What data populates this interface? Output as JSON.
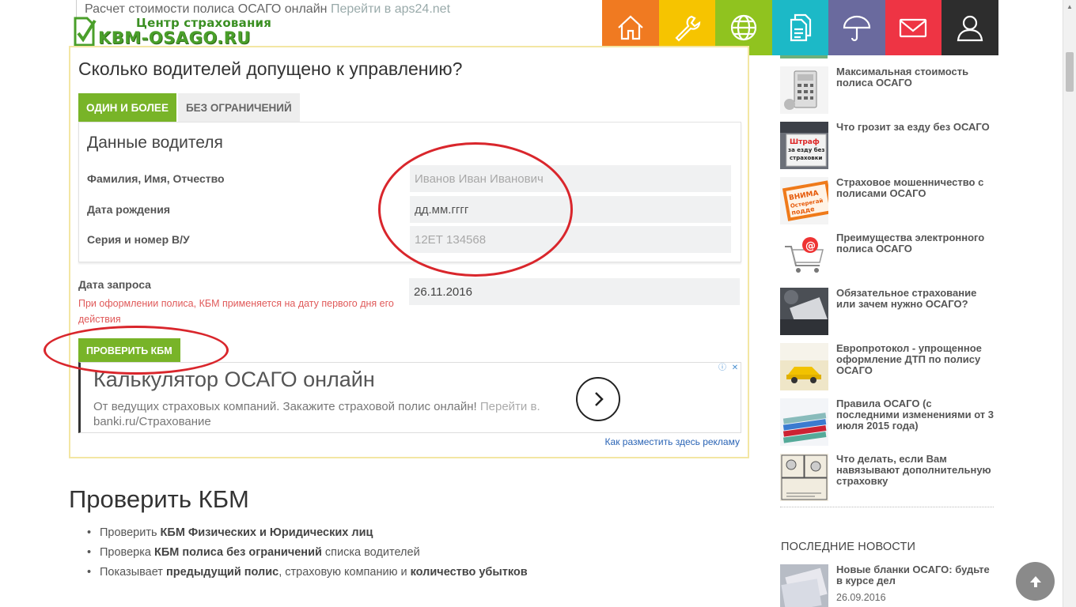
{
  "top_ad": {
    "text": "Расчет стоимости полиса ОСАГО онлайн",
    "link": "Перейти в aps24.net"
  },
  "logo": {
    "top_text": "Центр страхования",
    "main_text": "KBM-OSAGO.RU"
  },
  "topnav": [
    {
      "icon": "home-icon",
      "color": "#f07a21"
    },
    {
      "icon": "wrench-icon",
      "color": "#f6c400"
    },
    {
      "icon": "globe-icon",
      "color": "#90c31f"
    },
    {
      "icon": "documents-icon",
      "color": "#1cb9c7"
    },
    {
      "icon": "umbrella-icon",
      "color": "#6a6a9e"
    },
    {
      "icon": "mail-icon",
      "color": "#ee3444"
    },
    {
      "icon": "user-icon",
      "color": "#2d2d2d"
    }
  ],
  "form": {
    "question": "Сколько водителей допущено к управлению?",
    "tab_one": "ОДИН И БОЛЕЕ",
    "tab_unlimited": "БЕЗ ОГРАНИЧЕНИЙ",
    "driver_title": "Данные водителя",
    "fio_label": "Фамилия, Имя, Отчество",
    "fio_placeholder": "Иванов Иван Иванович",
    "birth_label": "Дата рождения",
    "birth_placeholder": "дд.мм.гггг",
    "license_label": "Серия и номер В/У",
    "license_placeholder": "12ЕТ 134568",
    "request_label": "Дата запроса",
    "request_note": "При оформлении полиса, КБМ применяется на дату первого дня его действия",
    "request_value": "26.11.2016",
    "check_button": "ПРОВЕРИТЬ КБМ"
  },
  "ad": {
    "title": "Калькулятор ОСАГО онлайн",
    "text": "От ведущих страховых компаний. Закажите страховой полис онлайн!",
    "link": "Перейти в.",
    "domain": "banki.ru/Страхование",
    "placement": "Как разместить здесь рекламу"
  },
  "section": {
    "title": "Проверить КБМ",
    "bullets": [
      {
        "pre": "Проверить ",
        "bold": "КБМ Физических и Юридических лиц",
        "post": "",
        "bold2": "",
        "post2": ""
      },
      {
        "pre": "Проверка ",
        "bold": "КБМ полиса без ограничений",
        "post": " списка водителей",
        "bold2": "",
        "post2": ""
      },
      {
        "pre": "Показывает ",
        "bold": "предыдущий полис",
        "post": ", страховую компанию и ",
        "bold2": "количество убытков",
        "post2": ""
      }
    ]
  },
  "sidebar": {
    "articles": [
      {
        "title": "Максимальная стоимость полиса ОСАГО"
      },
      {
        "title": "Что грозит за езду без ОСАГО",
        "thumb_text_1": "Штраф",
        "thumb_text_2": "за езду без",
        "thumb_text_3": "страховки"
      },
      {
        "title": "Страховое мошенничество с полисами ОСАГО",
        "thumb_text_1": "ВНИМА",
        "thumb_text_2": "Остерегай",
        "thumb_text_3": "подде"
      },
      {
        "title": "Преимущества электронного полиса ОСАГО"
      },
      {
        "title": "Обязательное страхование или зачем нужно ОСАГО?"
      },
      {
        "title": "Европротокол - упрощенное оформление ДТП по полису ОСАГО"
      },
      {
        "title": "Правила ОСАГО (с последними изменениями от 3 июля 2015 года)"
      },
      {
        "title": "Что делать, если Вам навязывают дополнительную страховку"
      }
    ],
    "news_heading": "ПОСЛЕДНИЕ НОВОСТИ",
    "news": [
      {
        "title": "Новые бланки ОСАГО: будьте в курсе дел",
        "date": "26.09.2016"
      }
    ]
  },
  "colors": {
    "accent_green": "#78b428",
    "annotation_red": "#d9262c",
    "note_red": "#e05a5a"
  }
}
